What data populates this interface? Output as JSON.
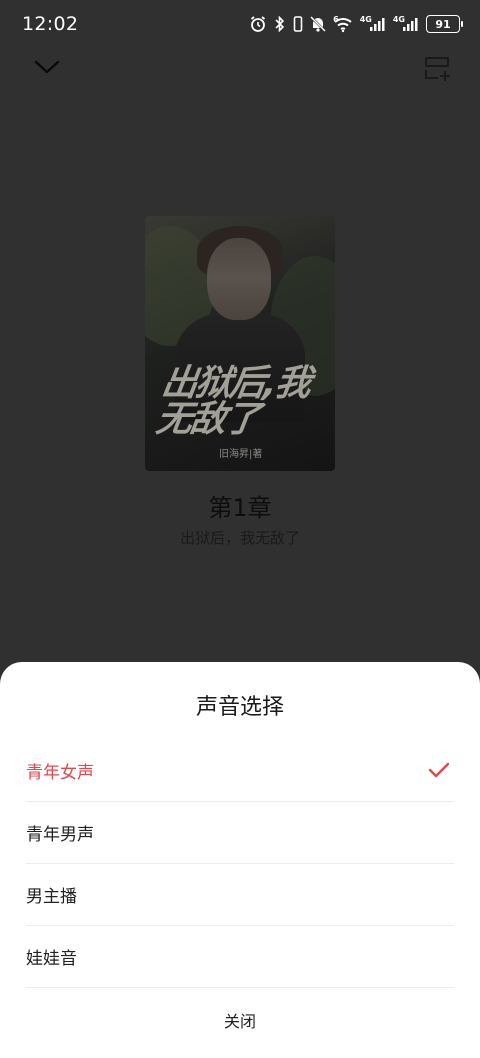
{
  "status_bar": {
    "time": "12:02",
    "network_a": "4G",
    "network_b": "4G",
    "wifi_badge": "6",
    "battery": "91"
  },
  "player": {
    "cover": {
      "title": "出狱后,我无敌了",
      "author_tag": "旧海昇|著"
    },
    "chapter_title": "第1章",
    "book_name": "出狱后，我无敌了"
  },
  "voice_sheet": {
    "title": "声音选择",
    "options": [
      {
        "label": "青年女声",
        "selected": true
      },
      {
        "label": "青年男声",
        "selected": false
      },
      {
        "label": "男主播",
        "selected": false
      },
      {
        "label": "娃娃音",
        "selected": false
      }
    ],
    "close_label": "关闭"
  },
  "colors": {
    "accent": "#e0484e",
    "overlay": "#303030"
  },
  "icons": [
    "alarm-icon",
    "bluetooth-icon",
    "vibrate-icon",
    "mute-icon",
    "wifi-icon",
    "signal-icon",
    "battery-icon",
    "chevron-down-icon",
    "add-to-list-icon",
    "check-icon"
  ]
}
